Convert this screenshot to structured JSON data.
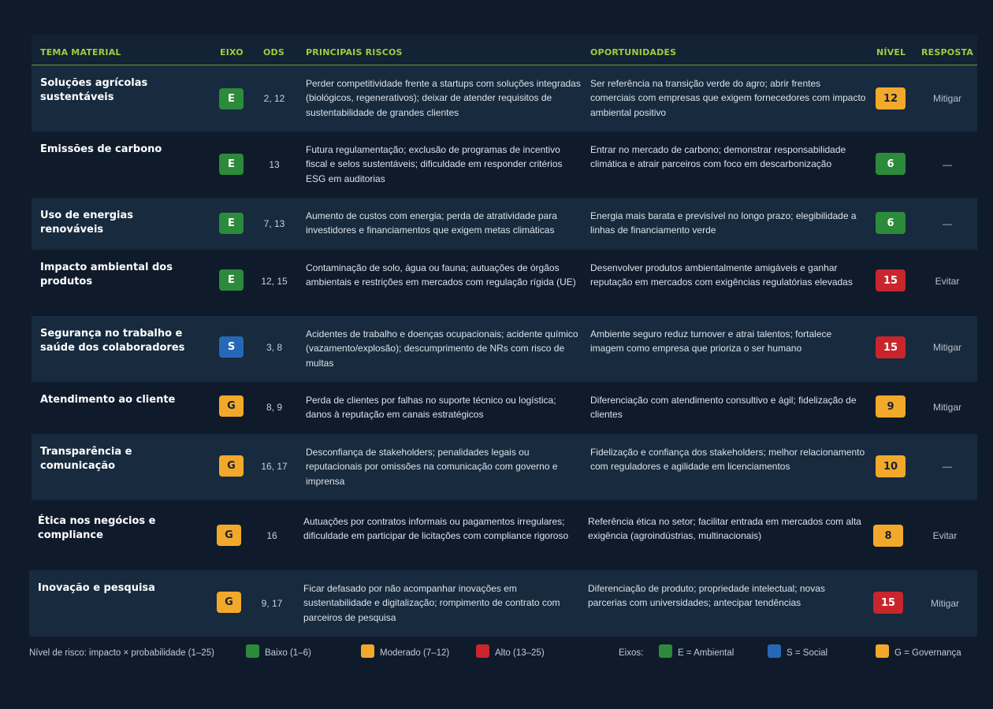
{
  "headers": {
    "tema": "TEMA MATERIAL",
    "eixo": "EIXO",
    "ods": "ODS",
    "riscos": "PRINCIPAIS RISCOS",
    "oportunidades": "OPORTUNIDADES",
    "nivel": "NÍVEL",
    "resposta": "RESPOSTA"
  },
  "colors": {
    "ambiental": "#2c8a3b",
    "social": "#2767b8",
    "governanca": "#f2a92b",
    "baixo": "#2c8a3b",
    "moderado": "#f2a92b",
    "alto": "#c9252c"
  },
  "rows": [
    {
      "tema": "Soluções agrícolas sustentáveis",
      "eixo": "E",
      "ods": "2, 12",
      "riscos": "Perder competitividade frente a startups com soluções integradas (biológicos, regenerativos); deixar de atender requisitos de sustentabilidade de grandes clientes",
      "oportunidades": "Ser referência na transição verde do agro; abrir frentes comerciais com empresas que exigem fornecedores com impacto ambiental positivo",
      "nivel": "12",
      "nivel_class": "moderado",
      "resposta": "Mitigar"
    },
    {
      "tema": "Emissões de carbono",
      "eixo": "E",
      "ods": "13",
      "riscos": "Futura regulamentação; exclusão de programas de incentivo fiscal e selos sustentáveis; dificuldade em responder critérios ESG em auditorias",
      "oportunidades": "Entrar no mercado de carbono; demonstrar responsabilidade climática e atrair parceiros com foco em descarbonização",
      "nivel": "6",
      "nivel_class": "baixo",
      "resposta": "—"
    },
    {
      "tema": "Uso de energias renováveis",
      "eixo": "E",
      "ods": "7, 13",
      "riscos": "Aumento de custos com energia; perda de atratividade para investidores e financiamentos que exigem metas climáticas",
      "oportunidades": "Energia mais barata e previsível no longo prazo; elegibilidade a linhas de financiamento verde",
      "nivel": "6",
      "nivel_class": "baixo",
      "resposta": "—"
    },
    {
      "tema": "Impacto ambiental dos produtos",
      "eixo": "E",
      "ods": "12, 15",
      "riscos": "Contaminação de solo, água ou fauna; autuações de órgãos ambientais e restrições em mercados com regulação rígida (UE)",
      "oportunidades": "Desenvolver produtos ambientalmente amigáveis e ganhar reputação em mercados com exigências regulatórias elevadas",
      "nivel": "15",
      "nivel_class": "alto",
      "resposta": "Evitar"
    },
    {
      "tema": "Segurança no trabalho e saúde dos colaboradores",
      "eixo": "S",
      "ods": "3, 8",
      "riscos": "Acidentes de trabalho e doenças ocupacionais; acidente químico (vazamento/explosão); descumprimento de NRs com risco de multas",
      "oportunidades": "Ambiente seguro reduz turnover e atrai talentos; fortalece imagem como empresa que prioriza o ser humano",
      "nivel": "15",
      "nivel_class": "alto",
      "resposta": "Mitigar"
    },
    {
      "tema": "Atendimento ao cliente",
      "eixo": "G",
      "ods": "8, 9",
      "riscos": "Perda de clientes por falhas no suporte técnico ou logística; danos à reputação em canais estratégicos",
      "oportunidades": "Diferenciação com atendimento consultivo e ágil; fidelização de clientes",
      "nivel": "9",
      "nivel_class": "moderado",
      "resposta": "Mitigar"
    },
    {
      "tema": "Transparência e comunicação",
      "eixo": "G",
      "ods": "16, 17",
      "riscos": "Desconfiança de stakeholders; penalidades legais ou reputacionais por omissões na comunicação com governo e imprensa",
      "oportunidades": "Fidelização e confiança dos stakeholders; melhor relacionamento com reguladores e agilidade em licenciamentos",
      "nivel": "10",
      "nivel_class": "moderado",
      "resposta": "—"
    },
    {
      "tema": "Ética nos negócios e compliance",
      "eixo": "G",
      "ods": "16",
      "riscos": "Autuações por contratos informais ou pagamentos irregulares; dificuldade em participar de licitações com compliance rigoroso",
      "oportunidades": "Referência ética no setor; facilitar entrada em mercados com alta exigência (agroindústrias, multinacionais)",
      "nivel": "8",
      "nivel_class": "moderado",
      "resposta": "Evitar"
    },
    {
      "tema": "Inovação e pesquisa",
      "eixo": "G",
      "ods": "9, 17",
      "riscos": "Ficar defasado por não acompanhar inovações em sustentabilidade e digitalização; rompimento de contrato com parceiros de pesquisa",
      "oportunidades": "Diferenciação de produto; propriedade intelectual; novas parcerias com universidades; antecipar tendências",
      "nivel": "15",
      "nivel_class": "alto",
      "resposta": "Mitigar"
    }
  ],
  "legend": {
    "nivel_title": "Nível de risco: impacto × probabilidade (1–25)",
    "baixo": "Baixo (1–6)",
    "moderado": "Moderado (7–12)",
    "alto": "Alto (13–25)",
    "eixos_title": "Eixos:",
    "ambiental": "E = Ambiental",
    "social": "S = Social",
    "governanca": "G = Governança"
  }
}
